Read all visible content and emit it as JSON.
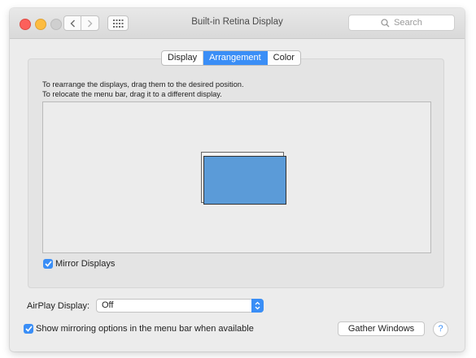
{
  "window": {
    "title": "Built-in Retina Display"
  },
  "toolbar": {
    "back_icon": "chevron-left-icon",
    "forward_icon": "chevron-right-icon",
    "grid_icon": "grid-icon",
    "search_placeholder": "Search"
  },
  "tabs": [
    {
      "label": "Display",
      "active": false
    },
    {
      "label": "Arrangement",
      "active": true
    },
    {
      "label": "Color",
      "active": false
    }
  ],
  "arrangement": {
    "instruction_line1": "To rearrange the displays, drag them to the desired position.",
    "instruction_line2": "To relocate the menu bar, drag it to a different display.",
    "mirror_label": "Mirror Displays",
    "mirror_checked": true
  },
  "airplay": {
    "label": "AirPlay Display:",
    "value": "Off"
  },
  "footer": {
    "show_mirroring_label": "Show mirroring options in the menu bar when available",
    "show_mirroring_checked": true,
    "gather_button": "Gather Windows",
    "help_label": "?"
  },
  "colors": {
    "accent": "#3a8ef6",
    "display_fill": "#5b9bd8"
  }
}
